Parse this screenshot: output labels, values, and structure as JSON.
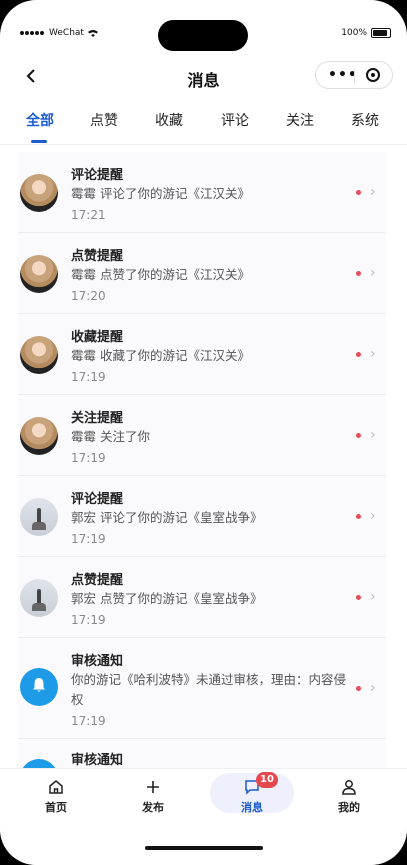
{
  "status_bar": {
    "carrier": "WeChat",
    "battery": "100%"
  },
  "nav": {
    "title": "消息"
  },
  "tabs": [
    {
      "label": "全部",
      "active": true
    },
    {
      "label": "点赞",
      "active": false
    },
    {
      "label": "收藏",
      "active": false
    },
    {
      "label": "评论",
      "active": false
    },
    {
      "label": "关注",
      "active": false
    },
    {
      "label": "系统",
      "active": false
    }
  ],
  "messages": [
    {
      "title": "评论提醒",
      "desc": "霉霉 评论了你的游记《江汉关》",
      "time": "17:21",
      "avatar": "woman-photo",
      "unread": true
    },
    {
      "title": "点赞提醒",
      "desc": "霉霉 点赞了你的游记《江汉关》",
      "time": "17:20",
      "avatar": "woman-photo",
      "unread": true
    },
    {
      "title": "收藏提醒",
      "desc": "霉霉 收藏了你的游记《江汉关》",
      "time": "17:19",
      "avatar": "woman-photo",
      "unread": true
    },
    {
      "title": "关注提醒",
      "desc": "霉霉 关注了你",
      "time": "17:19",
      "avatar": "woman-photo",
      "unread": true
    },
    {
      "title": "评论提醒",
      "desc": "郭宏 评论了你的游记《皇室战争》",
      "time": "17:19",
      "avatar": "man-photo",
      "unread": true
    },
    {
      "title": "点赞提醒",
      "desc": "郭宏 点赞了你的游记《皇室战争》",
      "time": "17:19",
      "avatar": "man-photo",
      "unread": true
    },
    {
      "title": "审核通知",
      "desc": "你的游记《哈利波特》未通过审核，理由：内容侵权",
      "time": "17:19",
      "avatar": "bell-icon",
      "unread": true
    },
    {
      "title": "审核通知",
      "desc": "",
      "time": "",
      "avatar": "bell-icon",
      "unread": false
    }
  ],
  "tabbar": [
    {
      "label": "首页",
      "icon": "home-icon"
    },
    {
      "label": "发布",
      "icon": "plus-icon"
    },
    {
      "label": "消息",
      "icon": "message-icon",
      "badge": "10",
      "active": true
    },
    {
      "label": "我的",
      "icon": "user-icon"
    }
  ],
  "colors": {
    "accent": "#1d5bd1",
    "unread_dot": "#e54d5b",
    "badge": "#e5484d",
    "bell_bg": "#1e9be6"
  }
}
